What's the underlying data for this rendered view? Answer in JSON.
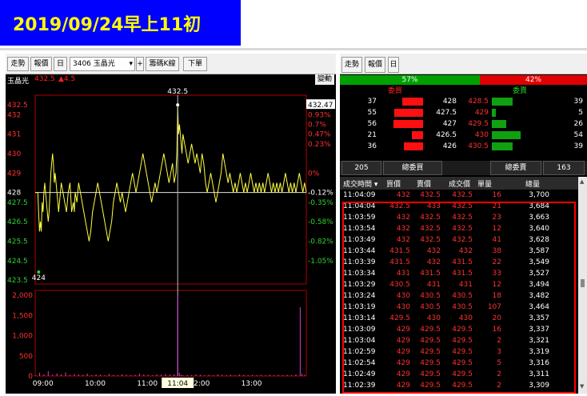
{
  "banner": {
    "text": "2019/09/24早上11初",
    "color": "#ffff00",
    "bg": "#0000ff"
  },
  "left_toolbar": {
    "trend": "走勢",
    "quote": "報價",
    "day": "日",
    "stock_select": "3406 玉晶光",
    "plus": "+",
    "chips_kline": "籌碼K線",
    "order": "下單",
    "dropdown_icon": "chevron-down-icon"
  },
  "stock": {
    "name": "玉晶光",
    "last": "432.5",
    "change": "▲4.5",
    "mode": "變動"
  },
  "right_toolbar": {
    "trend": "走勢",
    "quote": "報價",
    "day": "日"
  },
  "ratio": {
    "buy_pct": "57%",
    "sell_pct": "42%",
    "buy_frac": 0.57,
    "sell_frac": 0.42
  },
  "book": {
    "buy_label": "委買",
    "sell_label": "委賣",
    "rows": [
      {
        "bid_vol": "37",
        "bid_bar": 0.5,
        "bid": "428",
        "ask": "428.5",
        "ask_bar": 0.5,
        "ask_vol": "39"
      },
      {
        "bid_vol": "55",
        "bid_bar": 0.7,
        "bid": "427.5",
        "ask": "429",
        "ask_bar": 0.1,
        "ask_vol": "5"
      },
      {
        "bid_vol": "56",
        "bid_bar": 0.72,
        "bid": "427",
        "ask": "429.5",
        "ask_bar": 0.35,
        "ask_vol": "26"
      },
      {
        "bid_vol": "21",
        "bid_bar": 0.27,
        "bid": "426.5",
        "ask": "430",
        "ask_bar": 0.7,
        "ask_vol": "54"
      },
      {
        "bid_vol": "36",
        "bid_bar": 0.46,
        "bid": "426",
        "ask": "430.5",
        "ask_bar": 0.5,
        "ask_vol": "39"
      }
    ]
  },
  "totals": {
    "buy_total_value": "205",
    "buy_total_label": "總委買",
    "sell_total_label": "總委賣",
    "sell_total_value": "163"
  },
  "trade_headers": [
    "成交時間",
    "買價",
    "賣價",
    "成交價",
    "單量",
    "總量"
  ],
  "trades": [
    [
      "11:04:09",
      "432",
      "432.5",
      "432.5",
      "16",
      "3,700"
    ],
    [
      "11:04:04",
      "432.5",
      "433",
      "432.5",
      "21",
      "3,684"
    ],
    [
      "11:03:59",
      "432",
      "432.5",
      "432.5",
      "23",
      "3,663"
    ],
    [
      "11:03:54",
      "432",
      "432.5",
      "432.5",
      "12",
      "3,640"
    ],
    [
      "11:03:49",
      "432",
      "432.5",
      "432.5",
      "41",
      "3,628"
    ],
    [
      "11:03:44",
      "431.5",
      "432",
      "432",
      "38",
      "3,587"
    ],
    [
      "11:03:39",
      "431.5",
      "432",
      "431.5",
      "22",
      "3,549"
    ],
    [
      "11:03:34",
      "431",
      "431.5",
      "431.5",
      "33",
      "3,527"
    ],
    [
      "11:03:29",
      "430.5",
      "431",
      "431",
      "12",
      "3,494"
    ],
    [
      "11:03:24",
      "430",
      "430.5",
      "430.5",
      "18",
      "3,482"
    ],
    [
      "11:03:19",
      "430",
      "430.5",
      "430.5",
      "107",
      "3,464"
    ],
    [
      "11:03:14",
      "429.5",
      "430",
      "430",
      "20",
      "3,357"
    ],
    [
      "11:03:09",
      "429",
      "429.5",
      "429.5",
      "16",
      "3,337"
    ],
    [
      "11:03:04",
      "429",
      "429.5",
      "429.5",
      "2",
      "3,321"
    ],
    [
      "11:02:59",
      "429",
      "429.5",
      "429.5",
      "3",
      "3,319"
    ],
    [
      "11:02:54",
      "429",
      "429.5",
      "429.5",
      "5",
      "3,316"
    ],
    [
      "11:02:49",
      "429",
      "429.5",
      "429.5",
      "2",
      "3,311"
    ],
    [
      "11:02:39",
      "429",
      "429.5",
      "429.5",
      "2",
      "3,309"
    ]
  ],
  "chart_data": {
    "type": "line",
    "price_ticks": [
      "432.5",
      "432",
      "431",
      "430",
      "429",
      "428",
      "427.5",
      "426.5",
      "425.5",
      "424.5",
      "423.5"
    ],
    "pct_ticks": [
      "0.93%",
      "0.7%",
      "0.47%",
      "0.23%",
      "0%",
      "-0.12%",
      "-0.35%",
      "-0.58%",
      "-0.82%",
      "-1.05%"
    ],
    "price_tick_values": [
      432.5,
      432,
      431,
      430,
      429,
      428,
      427.5,
      426.5,
      425.5,
      424.5,
      423.5
    ],
    "pct_tick_prices": [
      432,
      431.5,
      431,
      430.5,
      429,
      428,
      427.5,
      426.5,
      425.5,
      424.5
    ],
    "ref_price": 428,
    "ylim": [
      423.3,
      433
    ],
    "high_label": "432.5",
    "low_label": "424",
    "last_label": "432.47",
    "cursor_time": "11:04",
    "x_ticks": [
      "09:00",
      "10:00",
      "11:00",
      "12:00",
      "13:00"
    ],
    "vol_ticks": [
      "2,000",
      "1,500",
      "1,000",
      "500",
      "0"
    ],
    "vol_max": 2000,
    "price_series": [
      [
        0,
        428
      ],
      [
        3,
        428
      ],
      [
        4,
        427
      ],
      [
        5,
        426
      ],
      [
        6,
        426.5
      ],
      [
        7,
        426
      ],
      [
        8,
        427.5
      ],
      [
        9,
        427
      ],
      [
        10,
        428
      ],
      [
        11,
        428.5
      ],
      [
        12,
        428
      ],
      [
        13,
        427.5
      ],
      [
        14,
        427
      ],
      [
        15,
        426.5
      ],
      [
        16,
        427
      ],
      [
        17,
        428
      ],
      [
        18,
        429
      ],
      [
        19,
        429.5
      ],
      [
        20,
        430
      ],
      [
        21,
        429.5
      ],
      [
        22,
        428.5
      ],
      [
        23,
        429
      ],
      [
        24,
        428.5
      ],
      [
        25,
        428
      ],
      [
        26,
        427.5
      ],
      [
        27,
        427
      ],
      [
        28,
        427.5
      ],
      [
        29,
        428
      ],
      [
        30,
        428.5
      ],
      [
        32,
        428
      ],
      [
        34,
        427.5
      ],
      [
        36,
        427
      ],
      [
        38,
        428
      ],
      [
        40,
        428.5
      ],
      [
        42,
        427
      ],
      [
        44,
        427.5
      ],
      [
        45,
        427
      ],
      [
        46,
        428
      ],
      [
        48,
        427.5
      ],
      [
        50,
        428.5
      ],
      [
        52,
        428
      ],
      [
        54,
        427.5
      ],
      [
        56,
        427
      ],
      [
        58,
        426.5
      ],
      [
        60,
        426
      ],
      [
        62,
        425.5
      ],
      [
        64,
        426
      ],
      [
        66,
        427
      ],
      [
        68,
        427.5
      ],
      [
        70,
        428
      ],
      [
        72,
        428.5
      ],
      [
        74,
        428
      ],
      [
        76,
        427.5
      ],
      [
        78,
        427
      ],
      [
        80,
        426.5
      ],
      [
        82,
        426
      ],
      [
        84,
        425.5
      ],
      [
        86,
        426
      ],
      [
        88,
        426.5
      ],
      [
        90,
        427.5
      ],
      [
        92,
        428
      ],
      [
        94,
        428.5
      ],
      [
        96,
        428
      ],
      [
        98,
        427.5
      ],
      [
        100,
        428
      ],
      [
        102,
        427.5
      ],
      [
        104,
        427
      ],
      [
        106,
        427.5
      ],
      [
        108,
        428
      ],
      [
        110,
        428.5
      ],
      [
        112,
        429
      ],
      [
        114,
        428.5
      ],
      [
        116,
        428
      ],
      [
        118,
        428.5
      ],
      [
        120,
        429
      ],
      [
        122,
        429.5
      ],
      [
        124,
        430
      ],
      [
        126,
        429.5
      ],
      [
        128,
        429
      ],
      [
        130,
        428.5
      ],
      [
        132,
        428
      ],
      [
        134,
        427.5
      ],
      [
        136,
        428
      ],
      [
        138,
        428.5
      ],
      [
        140,
        428
      ],
      [
        142,
        428.5
      ],
      [
        144,
        429
      ],
      [
        146,
        429.5
      ],
      [
        148,
        430
      ],
      [
        150,
        429.5
      ],
      [
        152,
        429
      ],
      [
        154,
        428.5
      ],
      [
        156,
        429
      ],
      [
        158,
        429.5
      ],
      [
        160,
        428.5
      ],
      [
        162,
        429
      ],
      [
        163,
        430
      ],
      [
        164,
        432.5
      ],
      [
        165,
        431
      ],
      [
        166,
        431.5
      ],
      [
        167,
        431
      ],
      [
        168,
        430.5
      ],
      [
        169,
        430
      ],
      [
        170,
        431
      ],
      [
        172,
        430.5
      ],
      [
        174,
        430
      ],
      [
        176,
        429.5
      ],
      [
        178,
        430
      ],
      [
        180,
        430.5
      ],
      [
        182,
        430
      ],
      [
        184,
        429.5
      ],
      [
        186,
        430
      ],
      [
        188,
        429.5
      ],
      [
        190,
        429
      ],
      [
        192,
        430
      ],
      [
        194,
        429.5
      ],
      [
        196,
        428.5
      ],
      [
        198,
        428
      ],
      [
        200,
        428.5
      ],
      [
        202,
        429
      ],
      [
        204,
        428.5
      ],
      [
        206,
        428
      ],
      [
        208,
        427.5
      ],
      [
        210,
        428
      ],
      [
        212,
        428.5
      ],
      [
        214,
        429
      ],
      [
        216,
        430
      ],
      [
        218,
        429.5
      ],
      [
        220,
        429
      ],
      [
        222,
        428.5
      ],
      [
        224,
        429
      ],
      [
        226,
        428.5
      ],
      [
        228,
        428
      ],
      [
        230,
        428.5
      ],
      [
        232,
        428
      ],
      [
        234,
        428.5
      ],
      [
        236,
        429
      ],
      [
        238,
        428.5
      ],
      [
        240,
        428
      ],
      [
        242,
        428.5
      ],
      [
        244,
        428
      ],
      [
        246,
        428.5
      ],
      [
        248,
        429
      ],
      [
        250,
        428.5
      ],
      [
        252,
        428
      ],
      [
        254,
        428.5
      ],
      [
        256,
        428
      ],
      [
        258,
        428.5
      ],
      [
        260,
        428
      ],
      [
        262,
        428.5
      ],
      [
        264,
        428
      ],
      [
        266,
        428.5
      ],
      [
        268,
        429
      ],
      [
        270,
        428.5
      ],
      [
        272,
        428
      ],
      [
        274,
        428.5
      ],
      [
        276,
        428
      ],
      [
        278,
        428.5
      ],
      [
        280,
        428
      ],
      [
        282,
        428.5
      ],
      [
        284,
        428
      ],
      [
        286,
        428.5
      ],
      [
        288,
        429
      ],
      [
        290,
        428.5
      ],
      [
        292,
        428
      ],
      [
        294,
        428.5
      ],
      [
        296,
        428
      ],
      [
        298,
        428.5
      ],
      [
        300,
        428
      ],
      [
        302,
        428.5
      ],
      [
        304,
        429
      ],
      [
        306,
        428.5
      ],
      [
        308,
        428
      ],
      [
        310,
        428.5
      ],
      [
        312,
        428
      ]
    ],
    "volume_series": [
      [
        0,
        20
      ],
      [
        5,
        80
      ],
      [
        10,
        40
      ],
      [
        15,
        120
      ],
      [
        20,
        30
      ],
      [
        25,
        60
      ],
      [
        30,
        40
      ],
      [
        35,
        90
      ],
      [
        40,
        30
      ],
      [
        45,
        50
      ],
      [
        50,
        40
      ],
      [
        55,
        30
      ],
      [
        60,
        60
      ],
      [
        65,
        20
      ],
      [
        70,
        40
      ],
      [
        75,
        30
      ],
      [
        80,
        20
      ],
      [
        85,
        50
      ],
      [
        90,
        30
      ],
      [
        95,
        20
      ],
      [
        100,
        40
      ],
      [
        105,
        30
      ],
      [
        110,
        20
      ],
      [
        115,
        30
      ],
      [
        120,
        60
      ],
      [
        125,
        40
      ],
      [
        130,
        30
      ],
      [
        135,
        20
      ],
      [
        140,
        40
      ],
      [
        145,
        30
      ],
      [
        150,
        50
      ],
      [
        155,
        30
      ],
      [
        160,
        40
      ],
      [
        164,
        2000
      ],
      [
        166,
        80
      ],
      [
        168,
        30
      ],
      [
        170,
        20
      ],
      [
        175,
        30
      ],
      [
        180,
        20
      ],
      [
        185,
        40
      ],
      [
        190,
        30
      ],
      [
        195,
        20
      ],
      [
        200,
        30
      ],
      [
        205,
        20
      ],
      [
        210,
        40
      ],
      [
        215,
        30
      ],
      [
        220,
        20
      ],
      [
        225,
        30
      ],
      [
        230,
        20
      ],
      [
        235,
        40
      ],
      [
        240,
        30
      ],
      [
        245,
        20
      ],
      [
        250,
        30
      ],
      [
        255,
        20
      ],
      [
        260,
        30
      ],
      [
        265,
        20
      ],
      [
        270,
        30
      ],
      [
        275,
        20
      ],
      [
        280,
        30
      ],
      [
        285,
        20
      ],
      [
        290,
        30
      ],
      [
        295,
        20
      ],
      [
        300,
        40
      ],
      [
        305,
        1700
      ],
      [
        307,
        60
      ],
      [
        310,
        30
      ]
    ]
  }
}
